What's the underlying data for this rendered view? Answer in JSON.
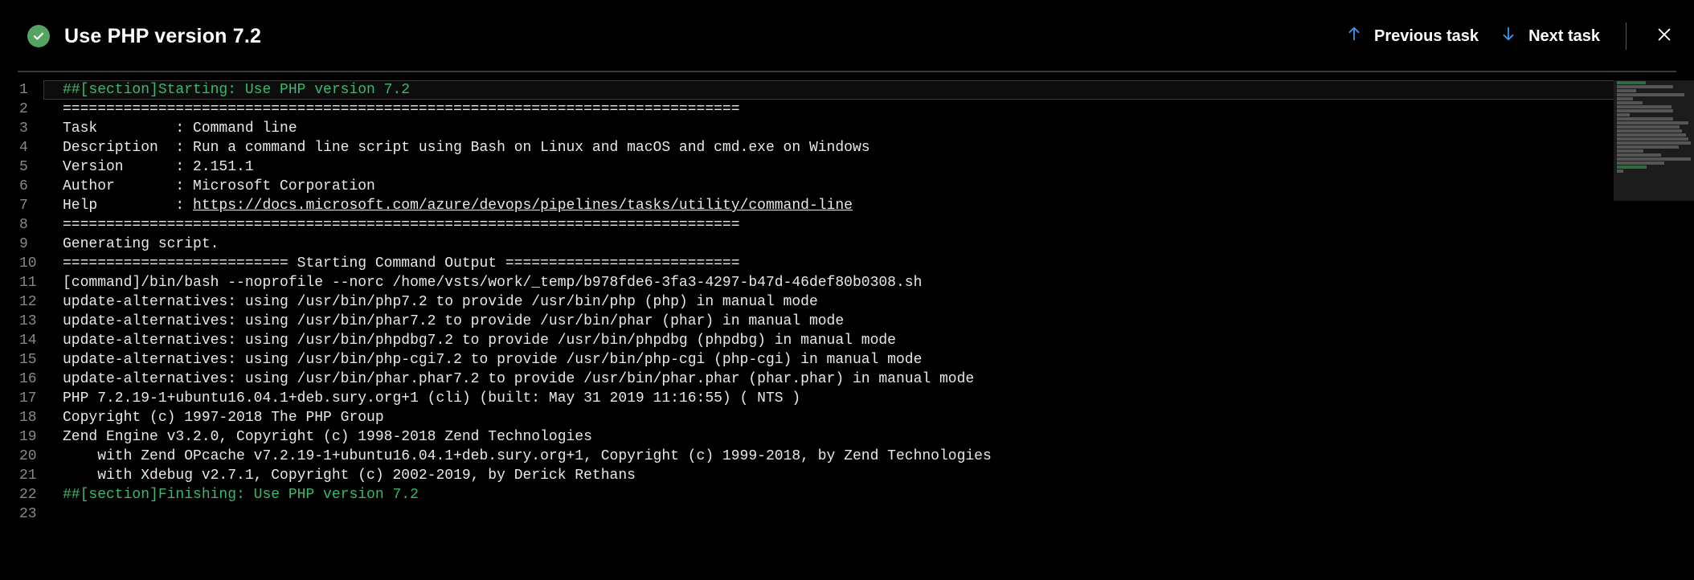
{
  "header": {
    "title": "Use PHP version 7.2",
    "status": "success",
    "prev_label": "Previous task",
    "next_label": "Next task"
  },
  "log": {
    "link_url": "https://docs.microsoft.com/azure/devops/pipelines/tasks/utility/command-line",
    "lines": [
      {
        "kind": "section",
        "text": "##[section]Starting: Use PHP version 7.2"
      },
      {
        "kind": "plain",
        "text": "=============================================================================="
      },
      {
        "kind": "plain",
        "text": "Task         : Command line"
      },
      {
        "kind": "plain",
        "text": "Description  : Run a command line script using Bash on Linux and macOS and cmd.exe on Windows"
      },
      {
        "kind": "plain",
        "text": "Version      : 2.151.1"
      },
      {
        "kind": "plain",
        "text": "Author       : Microsoft Corporation"
      },
      {
        "kind": "link",
        "prefix": "Help         : ",
        "text": "https://docs.microsoft.com/azure/devops/pipelines/tasks/utility/command-line"
      },
      {
        "kind": "plain",
        "text": "=============================================================================="
      },
      {
        "kind": "plain",
        "text": "Generating script."
      },
      {
        "kind": "plain",
        "text": "========================== Starting Command Output ==========================="
      },
      {
        "kind": "plain",
        "text": "[command]/bin/bash --noprofile --norc /home/vsts/work/_temp/b978fde6-3fa3-4297-b47d-46def80b0308.sh"
      },
      {
        "kind": "plain",
        "text": "update-alternatives: using /usr/bin/php7.2 to provide /usr/bin/php (php) in manual mode"
      },
      {
        "kind": "plain",
        "text": "update-alternatives: using /usr/bin/phar7.2 to provide /usr/bin/phar (phar) in manual mode"
      },
      {
        "kind": "plain",
        "text": "update-alternatives: using /usr/bin/phpdbg7.2 to provide /usr/bin/phpdbg (phpdbg) in manual mode"
      },
      {
        "kind": "plain",
        "text": "update-alternatives: using /usr/bin/php-cgi7.2 to provide /usr/bin/php-cgi (php-cgi) in manual mode"
      },
      {
        "kind": "plain",
        "text": "update-alternatives: using /usr/bin/phar.phar7.2 to provide /usr/bin/phar.phar (phar.phar) in manual mode"
      },
      {
        "kind": "plain",
        "text": "PHP 7.2.19-1+ubuntu16.04.1+deb.sury.org+1 (cli) (built: May 31 2019 11:16:55) ( NTS )"
      },
      {
        "kind": "plain",
        "text": "Copyright (c) 1997-2018 The PHP Group"
      },
      {
        "kind": "plain",
        "text": "Zend Engine v3.2.0, Copyright (c) 1998-2018 Zend Technologies"
      },
      {
        "kind": "plain",
        "text": "    with Zend OPcache v7.2.19-1+ubuntu16.04.1+deb.sury.org+1, Copyright (c) 1999-2018, by Zend Technologies"
      },
      {
        "kind": "plain",
        "text": "    with Xdebug v2.7.1, Copyright (c) 2002-2019, by Derick Rethans"
      },
      {
        "kind": "section",
        "text": "##[section]Finishing: Use PHP version 7.2"
      },
      {
        "kind": "plain",
        "text": ""
      }
    ],
    "current_line_index": 0
  }
}
